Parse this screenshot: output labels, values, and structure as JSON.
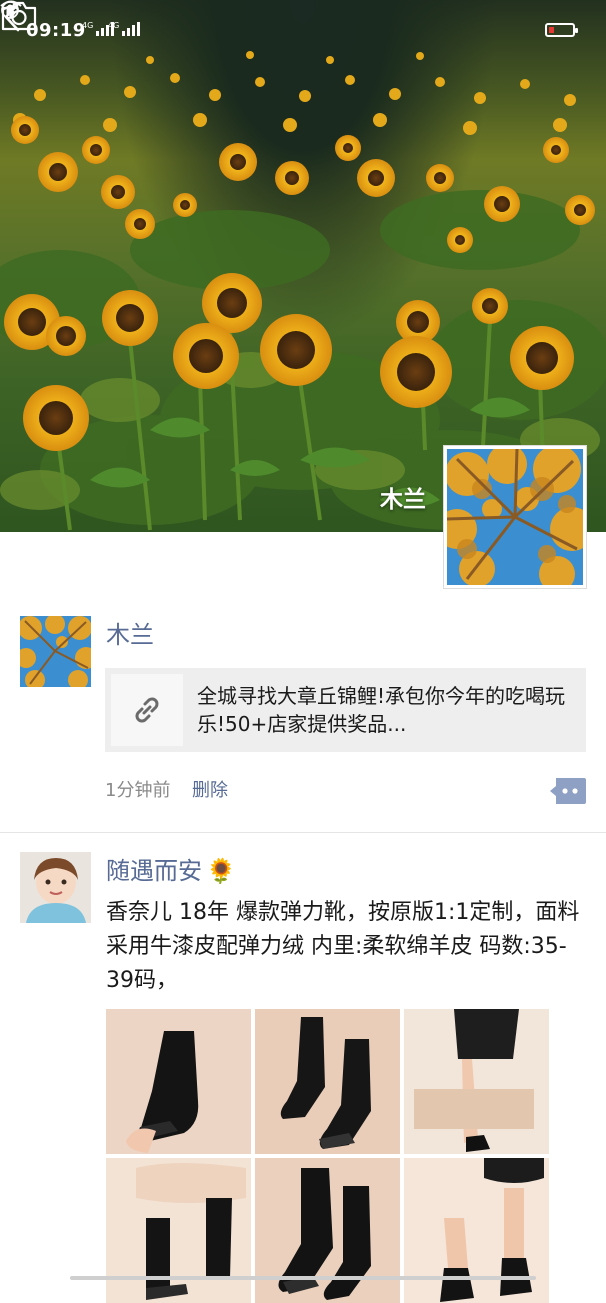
{
  "status_bar": {
    "time": "09:19",
    "network_1": "4G",
    "network_2": "4G",
    "battery_color": "#e53935"
  },
  "cover": {
    "back_icon": "chevron-left-icon",
    "camera_icon": "camera-icon",
    "owner_name": "木兰"
  },
  "posts": [
    {
      "author": "木兰",
      "link_card": {
        "icon": "link-icon",
        "title": "全城寻找大章丘锦鲤!承包你今年的吃喝玩乐!50+店家提供奖品..."
      },
      "time": "1分钟前",
      "delete_label": "删除",
      "comment_icon": "more-comment-icon"
    },
    {
      "author": "随遇而安",
      "author_emoji": "🌻",
      "text": "香奈儿 18年 爆款弹力靴，按原版1:1定制，面料采用牛漆皮配弹力绒 内里:柔软绵羊皮 码数:35-39码，",
      "photos": [
        "boot-photo-1",
        "boot-photo-2",
        "boot-photo-3",
        "boot-photo-4",
        "boot-photo-5",
        "boot-photo-6"
      ]
    }
  ],
  "colors": {
    "link_blue": "#576b95",
    "card_bg": "#eeeeee",
    "meta_gray": "#8a8a8a"
  }
}
